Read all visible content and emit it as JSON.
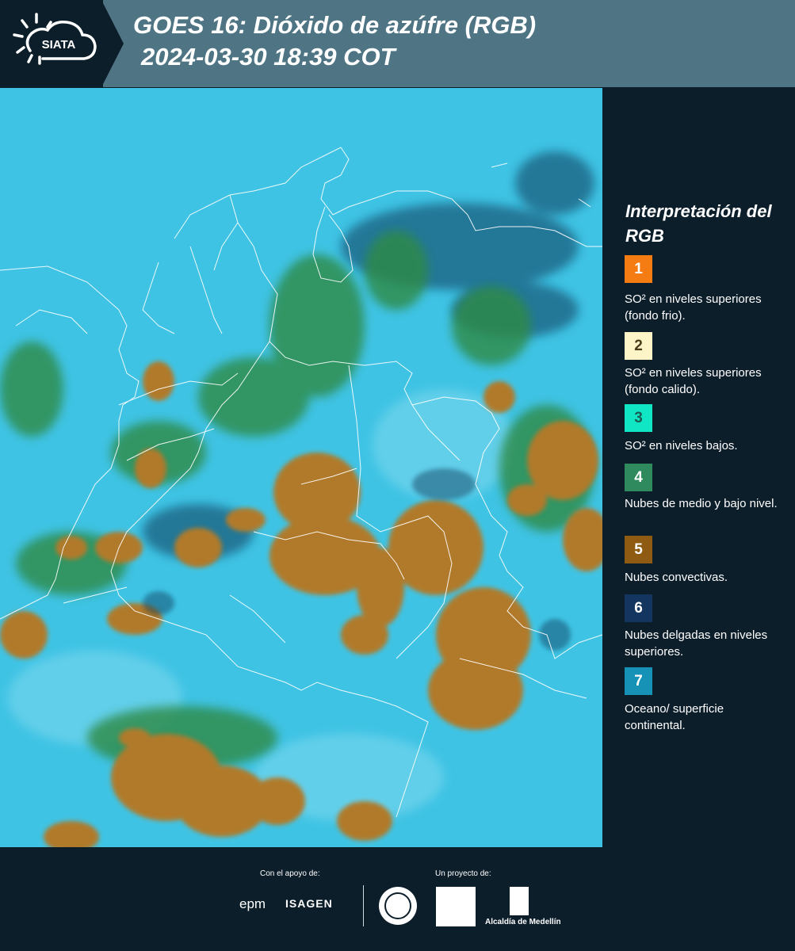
{
  "header": {
    "logo_text": "SIATA",
    "title_line1": "GOES 16: Dióxido de azúfre (RGB)",
    "title_line2": "2024-03-30 18:39 COT"
  },
  "map": {
    "background_color": "#3fc3e4",
    "cloud_colors": {
      "convective": "#b07a2a",
      "mid_low": "#2e8a45",
      "thin_upper": "#0d3a5a",
      "surface": "#3fc3e4"
    }
  },
  "legend": {
    "title": "Interpretación del RGB",
    "items": [
      {
        "number": "1",
        "color": "#f57c13",
        "text": "SO² en niveles superiores (fondo frio)."
      },
      {
        "number": "2",
        "color": "#fdf5c8",
        "text": "SO² en niveles superiores (fondo calido)."
      },
      {
        "number": "3",
        "color": "#11e6c4",
        "text": "SO² en niveles bajos."
      },
      {
        "number": "4",
        "color": "#2f8b5e",
        "text": "Nubes de medio y bajo nivel."
      },
      {
        "number": "5",
        "color": "#8f5a12",
        "text": "Nubes convectivas."
      },
      {
        "number": "6",
        "color": "#13355f",
        "text": "Nubes delgadas en niveles superiores."
      },
      {
        "number": "7",
        "color": "#1592b6",
        "text": "Oceano/ superficie continental."
      }
    ]
  },
  "footer": {
    "support_label": "Con el apoyo de:",
    "project_label": "Un proyecto de:",
    "epm": "epm",
    "isagen": "ISAGEN",
    "alcaldia": "Alcaldía de Medellín"
  }
}
